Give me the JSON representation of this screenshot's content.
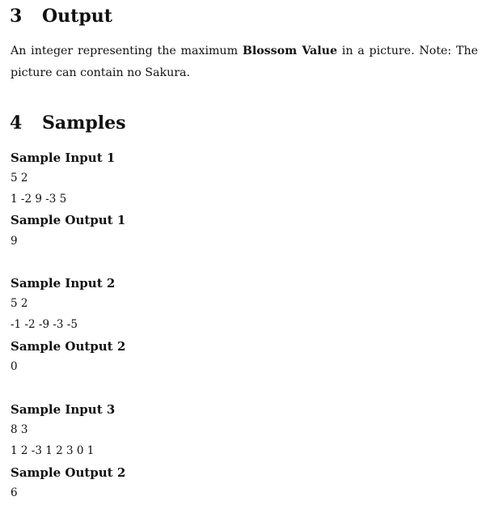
{
  "sections": {
    "output": {
      "number": "3",
      "title": "Output",
      "text_before": "An integer representing the maximum ",
      "bold_term": "Blossom Value",
      "text_after": " in a picture. Note: The picture can contain no Sakura."
    },
    "samples": {
      "number": "4",
      "title": "Samples"
    }
  },
  "samples": [
    {
      "input_label": "Sample Input 1",
      "input_lines": [
        "5 2",
        "1 -2 9 -3 5"
      ],
      "output_label": "Sample Output 1",
      "output_value": "9"
    },
    {
      "input_label": "Sample Input 2",
      "input_lines": [
        "5 2",
        "-1 -2 -9 -3 -5"
      ],
      "output_label": "Sample Output 2",
      "output_value": "0"
    },
    {
      "input_label": "Sample Input 3",
      "input_lines": [
        "8 3",
        "1 2 -3 1 2 3 0 1"
      ],
      "output_label": "Sample Output 2",
      "output_value": "6"
    }
  ]
}
